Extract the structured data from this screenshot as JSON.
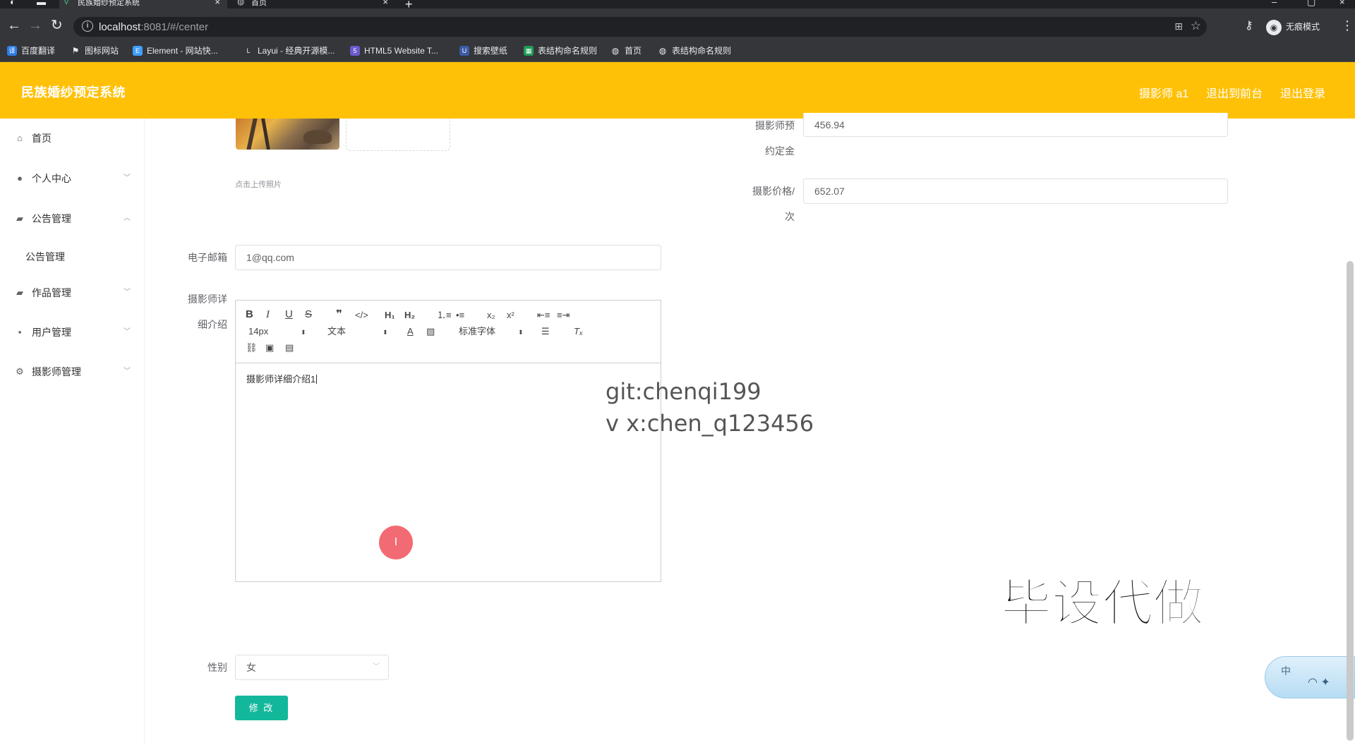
{
  "browser": {
    "tabs": [
      {
        "title": "民族婚纱预定系统",
        "active": true
      },
      {
        "title": "首页",
        "active": false
      }
    ],
    "url_host": "localhost",
    "url_path": ":8081/#/center",
    "incognito_label": "无痕模式",
    "bookmarks": [
      {
        "label": "百度翻译",
        "icon": "translate-icon",
        "color": "#2b7de9"
      },
      {
        "label": "图标网站",
        "icon": "flag-icon",
        "color": "#35363a"
      },
      {
        "label": "Element - 网站快...",
        "icon": "element-icon",
        "color": "#409eff"
      },
      {
        "label": "Layui - 经典开源模...",
        "icon": "layui-icon",
        "color": "#35363a"
      },
      {
        "label": "HTML5 Website T...",
        "icon": "html5-icon",
        "color": "#6a5acd"
      },
      {
        "label": "搜索壁纸",
        "icon": "wallpaper-icon",
        "color": "#3b5ba5"
      },
      {
        "label": "表结构命名规则",
        "icon": "sheet-icon",
        "color": "#1e9e57"
      },
      {
        "label": "首页",
        "icon": "globe-icon",
        "color": "#35363a"
      },
      {
        "label": "表结构命名规则",
        "icon": "globe-icon",
        "color": "#35363a"
      }
    ]
  },
  "header": {
    "brand": "民族婚纱预定系统",
    "user": "摄影师 a1",
    "to_front": "退出到前台",
    "logout": "退出登录",
    "color": "#ffc107"
  },
  "sidebar": {
    "items": [
      {
        "label": "首页",
        "icon": "home-icon"
      },
      {
        "label": "个人中心",
        "icon": "user-icon"
      },
      {
        "label": "公告管理",
        "icon": "briefcase-icon",
        "expanded": true
      },
      {
        "label": "作品管理",
        "icon": "briefcase-icon"
      },
      {
        "label": "用户管理",
        "icon": "chat-icon"
      },
      {
        "label": "摄影师管理",
        "icon": "settings-icon"
      }
    ],
    "submenu": [
      "公告管理"
    ]
  },
  "form": {
    "upload_tip": "点击上传照片",
    "deposit_label_1": "摄影师预",
    "deposit_label_2": "约定金",
    "deposit_value": "456.94",
    "price_label_1": "摄影价格/",
    "price_label_2": "次",
    "price_value": "652.07",
    "email_label": "电子邮箱",
    "email_value": "1@qq.com",
    "intro_label_1": "摄影师详",
    "intro_label_2": "细介绍",
    "intro_value": "摄影师详细介绍1",
    "gender_label": "性别",
    "gender_value": "女",
    "submit_label": "修 改"
  },
  "editor": {
    "font_size": "14px",
    "block_type": "文本",
    "font_family": "标准字体"
  },
  "overlay": {
    "git": "git:chenqi199",
    "vx": "v x:chen_q123456",
    "stamp": "毕设代做",
    "ime_char": "中"
  }
}
